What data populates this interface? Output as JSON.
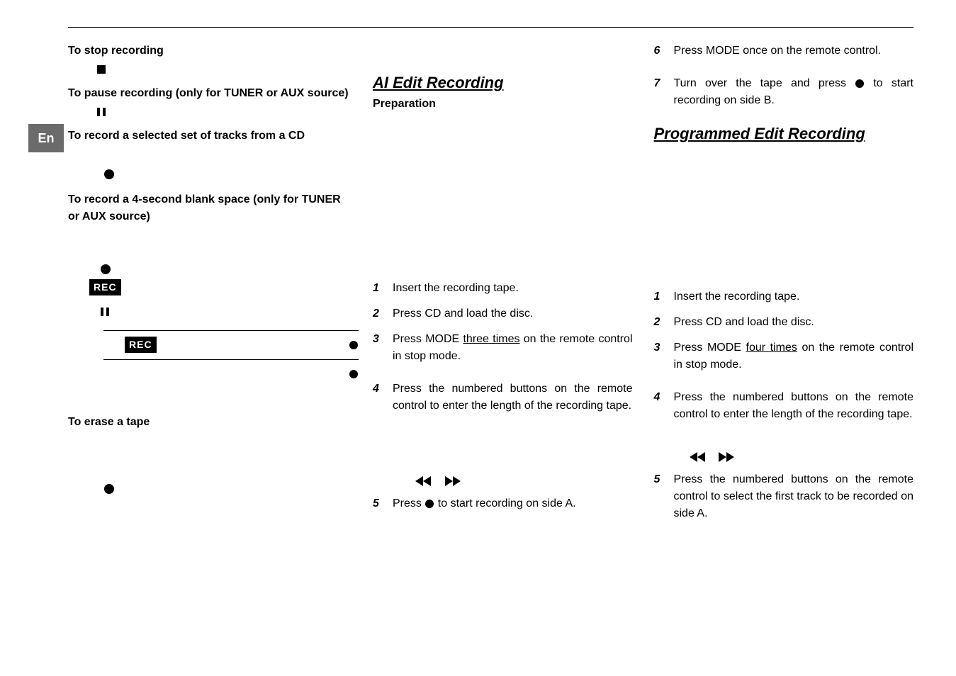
{
  "lang_tab": "En",
  "col1": {
    "h_stop": "To stop recording",
    "h_pause": "To pause recording (only for TUNER or AUX source)",
    "h_selset": "To record a selected set of tracks from a CD",
    "h_blank": "To record a 4-second blank space (only for TUNER or AUX source)",
    "rec_label": "REC",
    "h_erase": "To erase a tape"
  },
  "col2": {
    "title": "AI Edit Recording",
    "prep": "Preparation",
    "s1": "Insert the recording tape.",
    "s2": "Press CD and load the disc.",
    "s3a": "Press MODE ",
    "s3u": "three times",
    "s3b": " on the remote control in stop mode.",
    "s4": "Press the numbered buttons on the remote control to enter the length of the recording tape.",
    "s5a": "Press ",
    "s5b": " to start recording on side A."
  },
  "col3": {
    "s6": "Press MODE once on the remote control.",
    "s7a": "Turn over the tape and press ",
    "s7b": " to start recording on side B.",
    "title": "Programmed Edit Recording",
    "s1": "Insert the recording tape.",
    "s2": "Press CD and load the disc.",
    "s3a": "Press MODE ",
    "s3u": "four times",
    "s3b": " on the remote control in stop mode.",
    "s4": "Press the numbered buttons on the remote control to enter the length of the recording tape.",
    "s5": "Press the numbered buttons on the remote control to select the first track to be recorded on side A."
  },
  "nums": {
    "n1": "1",
    "n2": "2",
    "n3": "3",
    "n4": "4",
    "n5": "5",
    "n6": "6",
    "n7": "7"
  }
}
